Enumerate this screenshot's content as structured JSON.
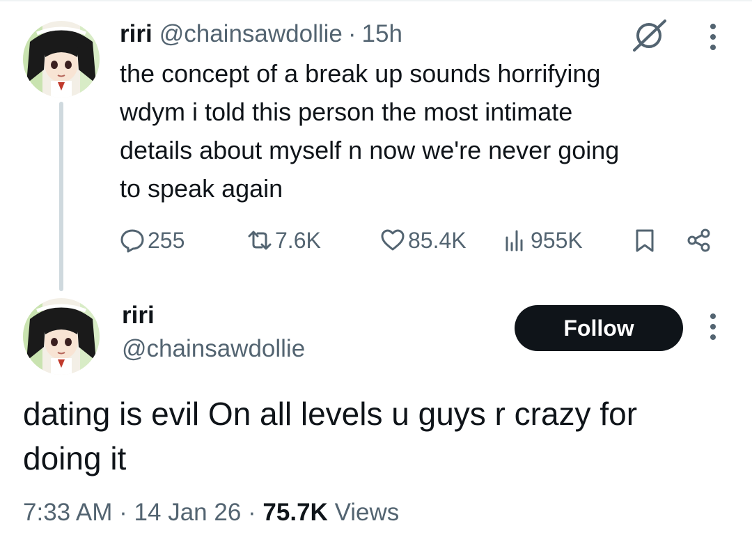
{
  "post1": {
    "display_name": "riri",
    "handle": "@chainsawdollie",
    "separator": "·",
    "time": "15h",
    "text": "the concept of a break up sounds horrifying\nwdym i told this person the most intimate\ndetails about myself n now we're never going\nto speak again",
    "stats": {
      "replies": "255",
      "reposts": "7.6K",
      "likes": "85.4K",
      "views": "955K"
    }
  },
  "post2": {
    "display_name": "riri",
    "handle": "@chainsawdollie",
    "follow_label": "Follow",
    "text": "dating is evil On all levels u guys r crazy for\ndoing it",
    "timestamp": "7:33 AM",
    "date": "14 Jan 26",
    "separator": "·",
    "views_count": "75.7K",
    "views_label": "Views"
  },
  "icons": {
    "grok": "grok-icon",
    "more": "more-vertical-icon",
    "reply": "reply-icon",
    "repost": "repost-icon",
    "like": "heart-icon",
    "views": "views-bar-icon",
    "bookmark": "bookmark-icon",
    "share": "share-icon"
  },
  "colors": {
    "text_primary": "#0f1419",
    "text_secondary": "#536471",
    "thread_line": "#cfd9de",
    "follow_bg": "#0f1419",
    "follow_text": "#ffffff"
  }
}
